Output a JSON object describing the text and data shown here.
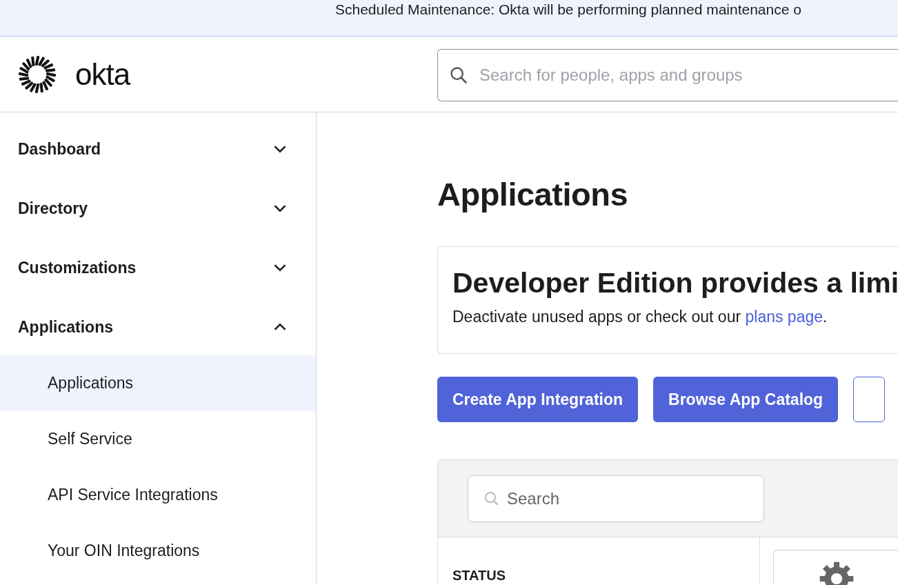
{
  "banner": {
    "text": "Scheduled Maintenance: Okta will be performing planned maintenance o"
  },
  "header": {
    "logo": "okta",
    "search": {
      "placeholder": "Search for people, apps and groups"
    }
  },
  "sidebar": {
    "items": [
      {
        "label": "Dashboard",
        "expanded": false
      },
      {
        "label": "Directory",
        "expanded": false
      },
      {
        "label": "Customizations",
        "expanded": false
      },
      {
        "label": "Applications",
        "expanded": true,
        "children": [
          {
            "label": "Applications",
            "selected": true
          },
          {
            "label": "Self Service",
            "selected": false
          },
          {
            "label": "API Service Integrations",
            "selected": false
          },
          {
            "label": "Your OIN Integrations",
            "selected": false
          }
        ]
      }
    ]
  },
  "page": {
    "title": "Applications",
    "notice": {
      "heading": "Developer Edition provides a limi",
      "text_before": "Deactivate unused apps or check out our ",
      "link": "plans page",
      "text_after": "."
    },
    "buttons": [
      {
        "label": "Create App Integration",
        "kind": "primary"
      },
      {
        "label": "Browse App Catalog",
        "kind": "primary"
      },
      {
        "kind": "outline"
      }
    ],
    "table": {
      "search": {
        "placeholder": "Search"
      },
      "filter_heading": "STATUS"
    }
  }
}
